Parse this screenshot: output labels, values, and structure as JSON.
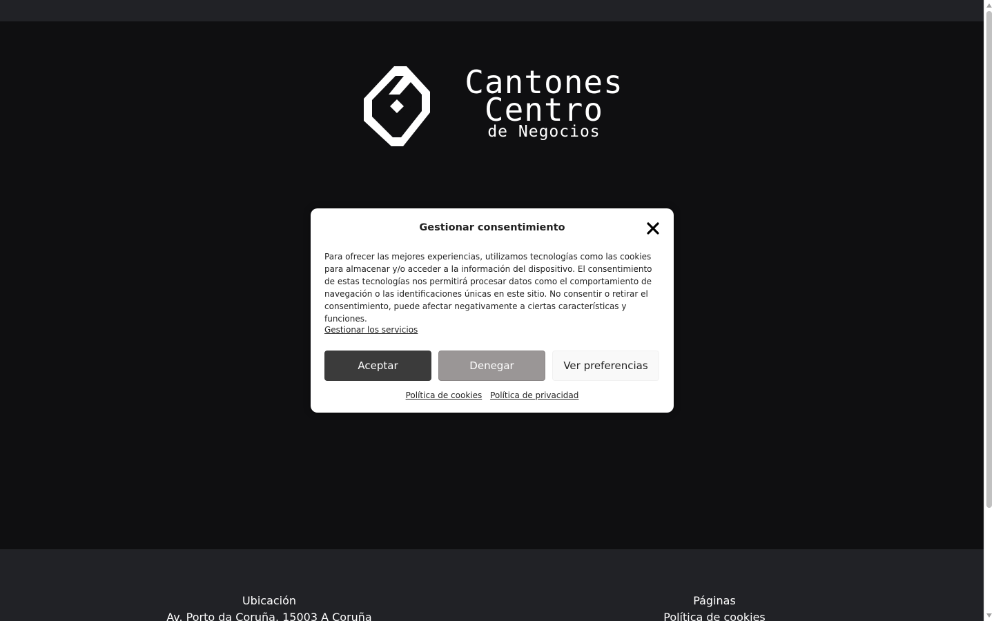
{
  "header": {
    "logo": {
      "line1": "Cantones",
      "line2": "Centro",
      "line3": "de Negocios",
      "icon": "cantones-logo-mark"
    }
  },
  "cookie_dialog": {
    "title": "Gestionar consentimiento",
    "close_icon": "close-icon",
    "message": "Para ofrecer las mejores experiencias, utilizamos tecnologías como las cookies para almacenar y/o acceder a la información del dispositivo. El consentimiento de estas tecnologías nos permitirá procesar datos como el comportamiento de navegación o las identificaciones únicas en este sitio. No consentir o retirar el consentimiento, puede afectar negativamente a ciertas características y funciones.",
    "manage_services_label": "Gestionar los servicios",
    "accept_label": "Aceptar",
    "deny_label": "Denegar",
    "preferences_label": "Ver preferencias",
    "cookie_policy_label": "Política de cookies",
    "privacy_policy_label": "Política de privacidad"
  },
  "footer": {
    "location": {
      "heading": "Ubicación",
      "address": "Av. Porto da Coruña, 15003 A Coruña"
    },
    "pages": {
      "heading": "Páginas",
      "cookie_policy": "Política de cookies"
    }
  },
  "colors": {
    "background": "#0f0f11",
    "bars": "#212226",
    "accept_button": "#3b3b3b",
    "deny_button": "#9a9696",
    "preferences_button": "#f9f9f9"
  }
}
